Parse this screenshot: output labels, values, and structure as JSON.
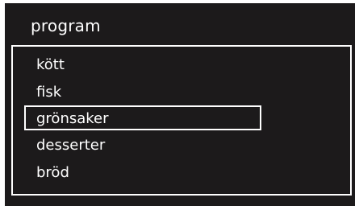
{
  "menu": {
    "title": "program",
    "items": [
      {
        "label": "kött",
        "selected": false
      },
      {
        "label": "fisk",
        "selected": false
      },
      {
        "label": "grönsaker",
        "selected": true
      },
      {
        "label": "desserter",
        "selected": false
      },
      {
        "label": "bröd",
        "selected": false
      }
    ]
  },
  "colors": {
    "background": "#1c1a1b",
    "text": "#ffffff",
    "frame": "#ffffff"
  }
}
